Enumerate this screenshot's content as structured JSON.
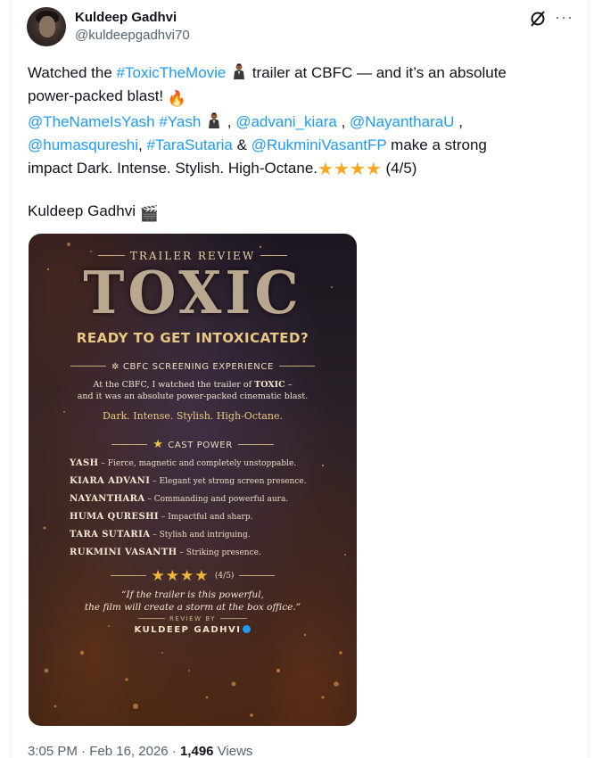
{
  "author": {
    "display_name": "Kuldeep Gadhvi",
    "handle": "@kuldeepgadhvi70",
    "avatar_icon": "avatar-photo"
  },
  "header_actions": {
    "grok_icon": "grok-icon",
    "more_label": "···"
  },
  "tweet": {
    "line1_pre": "Watched the ",
    "line1_hashtag": "#ToxicTheMovie",
    "line1_post": " trailer at CBFC — and it’s an absolute",
    "line2": "power-packed blast! ",
    "line2_emoji": "🔥",
    "line3_mention1": "@TheNameIsYash",
    "line3_hashtag": "#Yash",
    "line3_sep1": " , ",
    "line3_mention2": "@advani_kiara",
    "line3_sep2": " , ",
    "line3_mention3": "@NayantharaU",
    "line3_sep3": " ,",
    "line4_mention4": "@humasqureshi",
    "line4_sep1": ", ",
    "line4_hashtag": "#TaraSutaria",
    "line4_amp": " & ",
    "line4_mention5": "@RukminiVasantFP",
    "line4_post": " make a strong",
    "line5_pre": "impact Dark. Intense. Stylish. High-Octane.",
    "line5_rating": "(4/5)",
    "rating_stars": "★★★★",
    "signoff": "Kuldeep Gadhvi ",
    "signoff_emoji": "🎬"
  },
  "poster": {
    "kicker": "TRAILER REVIEW",
    "title": "TOXIC",
    "subtitle": "READY TO GET INTOXICATED?",
    "section1": "CBFC SCREENING EXPERIENCE",
    "body1_a": "At the CBFC, I watched the trailer of ",
    "body1_hl": "TOXIC",
    "body1_b": " –",
    "body1_c": "and it was an absolute power-packed cinematic blast.",
    "tagline": "Dark. Intense. Stylish. High-Octane.",
    "section2": "CAST POWER",
    "cast": [
      {
        "name": "YASH",
        "note": " – Fierce, magnetic and completely unstoppable."
      },
      {
        "name": "KIARA ADVANI",
        "note": " – Elegant yet strong screen presence."
      },
      {
        "name": "NAYANTHARA",
        "note": " – Commanding and powerful aura."
      },
      {
        "name": "HUMA QURESHI",
        "note": " – Impactful and sharp."
      },
      {
        "name": "TARA SUTARIA",
        "note": " – Stylish and intriguing."
      },
      {
        "name": "RUKMINI VASANTH",
        "note": " – Striking presence."
      }
    ],
    "rating_stars": "★★★★",
    "rating_text": "(4/5)",
    "quote_1": "“If the trailer is this powerful,",
    "quote_2": "the film will create a storm at the box office.”",
    "review_by": "REVIEW BY",
    "critic": "KULDEEP GADHVI"
  },
  "meta": {
    "time": "3:05 PM",
    "date": "Feb 16, 2026",
    "views_count": "1,496",
    "views_label": "Views"
  }
}
